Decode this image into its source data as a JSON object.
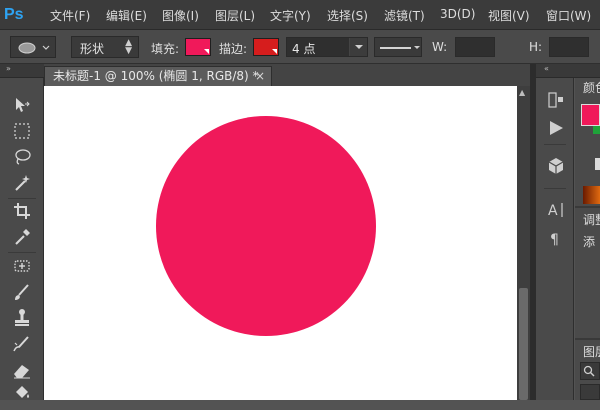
{
  "app": {
    "logo": "Ps"
  },
  "menu": [
    "文件(F)",
    "编辑(E)",
    "图像(I)",
    "图层(L)",
    "文字(Y)",
    "选择(S)",
    "滤镜(T)",
    "3D(D)",
    "视图(V)",
    "窗口(W)"
  ],
  "options": {
    "mode_value": "形状",
    "fill_label": "填充:",
    "stroke_label": "描边:",
    "stroke_width_value": "4 点",
    "width_label": "W:",
    "height_label": "H:",
    "fill_color": "#f0195a",
    "stroke_color": "#d61d1d"
  },
  "document": {
    "tab_title": "未标题-1 @ 100% (椭圆 1, RGB/8) *",
    "close_glyph": "×",
    "shape_fill": "#f0195a"
  },
  "right_panel": {
    "color_tab": "颜色",
    "adjust_tab": "调整",
    "add_label": "添",
    "layers_tab": "图层",
    "fg_color": "#f0195a",
    "bg_color": "#1fa33a"
  },
  "icons": {
    "move": "move-icon",
    "marquee": "rect-marquee-icon",
    "lasso": "lasso-icon",
    "magic_wand": "magic-wand-icon",
    "crop": "crop-icon",
    "eyedropper": "eyedropper-icon",
    "healing": "healing-brush-icon",
    "brush": "brush-icon",
    "stamp": "clone-stamp-icon",
    "history_brush": "history-brush-icon",
    "eraser": "eraser-icon",
    "bucket": "paint-bucket-icon"
  }
}
